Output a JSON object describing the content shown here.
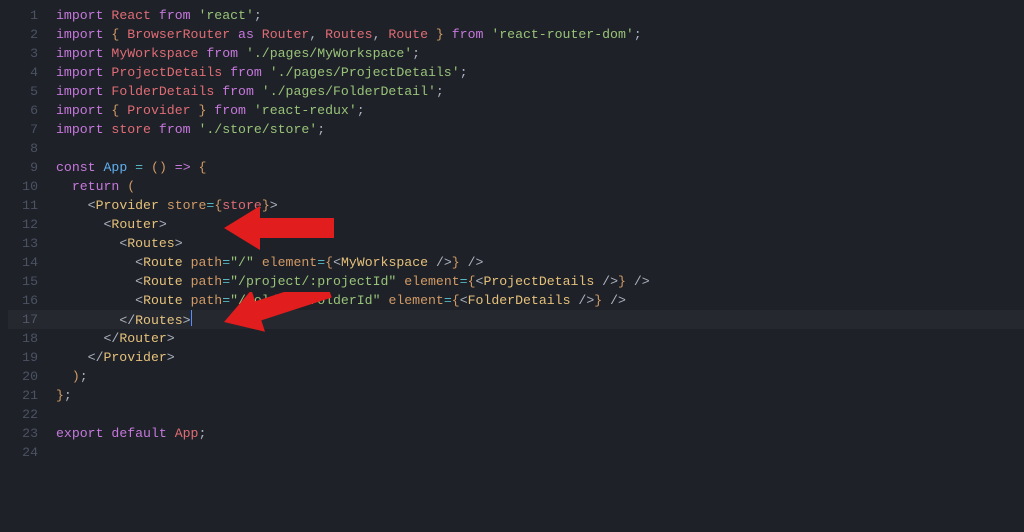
{
  "editor": {
    "line_count": 24,
    "highlighted_line": 17,
    "lines": {
      "l1": {
        "kw1": "import",
        "id1": "React",
        "kw2": "from",
        "str1": "'react'",
        "sc": ";"
      },
      "l2": {
        "kw1": "import",
        "br1": "{ ",
        "id1": "BrowserRouter",
        "kw2": "as",
        "id2": "Router",
        "c1": ", ",
        "id3": "Routes",
        "c2": ", ",
        "id4": "Route",
        "br2": " }",
        "kw3": "from",
        "str1": "'react-router-dom'",
        "sc": ";"
      },
      "l3": {
        "kw1": "import",
        "id1": "MyWorkspace",
        "kw2": "from",
        "str1": "'./pages/MyWorkspace'",
        "sc": ";"
      },
      "l4": {
        "kw1": "import",
        "id1": "ProjectDetails",
        "kw2": "from",
        "str1": "'./pages/ProjectDetails'",
        "sc": ";"
      },
      "l5": {
        "kw1": "import",
        "id1": "FolderDetails",
        "kw2": "from",
        "str1": "'./pages/FolderDetail'",
        "sc": ";"
      },
      "l6": {
        "kw1": "import",
        "br1": "{ ",
        "id1": "Provider",
        "br2": " }",
        "kw2": "from",
        "str1": "'react-redux'",
        "sc": ";"
      },
      "l7": {
        "kw1": "import",
        "id1": "store",
        "kw2": "from",
        "str1": "'./store/store'",
        "sc": ";"
      },
      "l9": {
        "kw1": "const",
        "fn1": "App",
        "eq": "=",
        "lp": "(",
        "rp": ")",
        "ar": "=>",
        "cb": "{"
      },
      "l10": {
        "kw1": "return",
        "lp": "("
      },
      "l11": {
        "lt": "<",
        "tag": "Provider",
        "attr": "store",
        "eq": "=",
        "cb1": "{",
        "id": "store",
        "cb2": "}",
        "gt": ">"
      },
      "l12": {
        "lt": "<",
        "tag": "Router",
        "gt": ">"
      },
      "l13": {
        "lt": "<",
        "tag": "Routes",
        "gt": ">"
      },
      "l14": {
        "lt": "<",
        "tag": "Route",
        "attr1": "path",
        "eq1": "=",
        "str1": "\"/\"",
        "attr2": "element",
        "eq2": "=",
        "cb1": "{",
        "lt2": "<",
        "cmp": "MyWorkspace",
        "se": "/>",
        "cb2": "}",
        "se2": "/>"
      },
      "l15": {
        "lt": "<",
        "tag": "Route",
        "attr1": "path",
        "eq1": "=",
        "str1": "\"/project/:projectId\"",
        "attr2": "element",
        "eq2": "=",
        "cb1": "{",
        "lt2": "<",
        "cmp": "ProjectDetails",
        "se": "/>",
        "cb2": "}",
        "se2": "/>"
      },
      "l16": {
        "lt": "<",
        "tag": "Route",
        "attr1": "path",
        "eq1": "=",
        "str1": "\"/folder/:folderId\"",
        "attr2": "element",
        "eq2": "=",
        "cb1": "{",
        "lt2": "<",
        "cmp": "FolderDetails",
        "se": "/>",
        "cb2": "}",
        "se2": "/>"
      },
      "l17": {
        "lt": "</",
        "tag": "Routes",
        "gt": ">"
      },
      "l18": {
        "lt": "</",
        "tag": "Router",
        "gt": ">"
      },
      "l19": {
        "lt": "</",
        "tag": "Provider",
        "gt": ">"
      },
      "l20": {
        "rp": ")",
        "sc": ";"
      },
      "l21": {
        "cb": "}",
        "sc": ";"
      },
      "l23": {
        "kw1": "export",
        "kw2": "default",
        "id1": "App",
        "sc": ";"
      }
    }
  }
}
